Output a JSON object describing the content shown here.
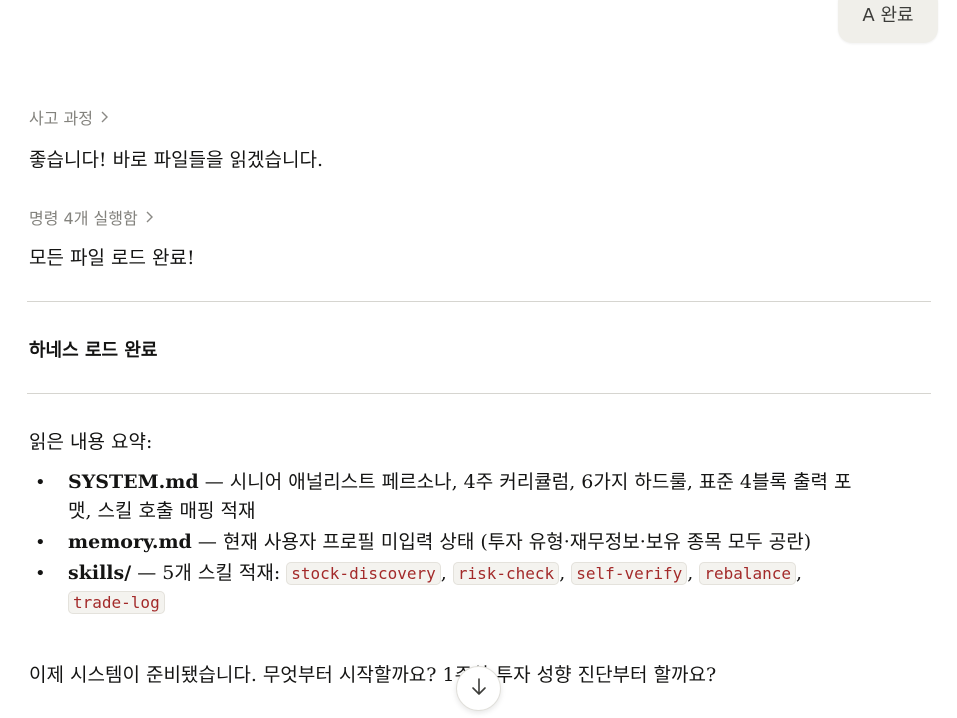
{
  "user_message": {
    "label": "A 완료"
  },
  "thinking_toggle": {
    "label": "사고 과정"
  },
  "reply_1": "좋습니다! 바로 파일들을 읽겠습니다.",
  "commands_toggle": {
    "label": "명령 4개 실행함"
  },
  "reply_2": "모든 파일 로드 완료!",
  "section_heading": "하네스 로드 완료",
  "summary_intro": "읽은 내용 요약:",
  "files": [
    {
      "name": "SYSTEM.md",
      "sep": " — ",
      "desc": "시니어 애널리스트 페르소나, 4주 커리큘럼, 6가지 하드룰, 표준 4블록 출력 포",
      "desc_cont": "맷, 스킬 호출 매핑 적재"
    },
    {
      "name": "memory.md",
      "sep": " — ",
      "desc": "현재 사용자 프로필 미입력 상태 (투자 유형·재무정보·보유 종목 모두 공란)"
    },
    {
      "name": "skills/",
      "sep": " — ",
      "desc": "5개 스킬 적재: ",
      "skills": [
        "stock-discovery",
        "risk-check",
        "self-verify",
        "rebalance",
        "trade-log"
      ]
    }
  ],
  "closing": "이제 시스템이 준비됐습니다. 무엇부터 시작할까요? 1주차 투자 성향 진단부터 할까요?",
  "icons": {
    "chevron": "chevron-right-icon",
    "scroll": "arrow-down-icon"
  }
}
